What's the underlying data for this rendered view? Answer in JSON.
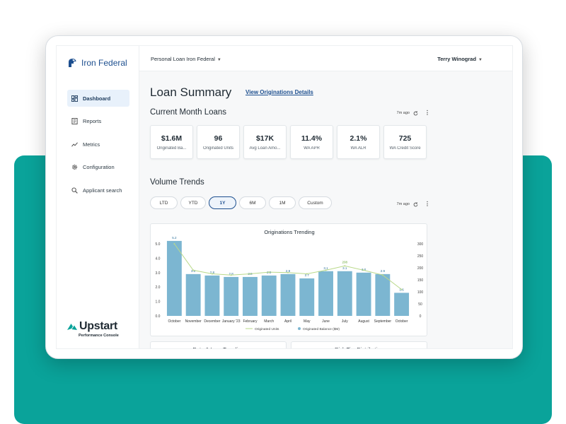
{
  "brand": {
    "name": "Iron Federal"
  },
  "sidebar": {
    "items": [
      {
        "label": "Dashboard",
        "icon": "dashboard-icon",
        "active": true
      },
      {
        "label": "Reports",
        "icon": "reports-icon",
        "active": false
      },
      {
        "label": "Metrics",
        "icon": "metrics-icon",
        "active": false
      },
      {
        "label": "Configuration",
        "icon": "gear-icon",
        "active": false
      },
      {
        "label": "Applicant search",
        "icon": "search-icon",
        "active": false
      }
    ],
    "footer": {
      "name": "Upstart",
      "subtitle": "Performance Console"
    }
  },
  "topbar": {
    "product": "Personal Loan Iron Federal",
    "user": "Terry Winograd"
  },
  "page": {
    "title": "Loan Summary",
    "details_link": "View Originations Details"
  },
  "current_month": {
    "title": "Current Month Loans",
    "updated": "7m ago",
    "kpis": [
      {
        "value": "$1.6M",
        "label": "Originated Ba..."
      },
      {
        "value": "96",
        "label": "Originated Units"
      },
      {
        "value": "$17K",
        "label": "Avg Loan Amo..."
      },
      {
        "value": "11.4%",
        "label": "WA APR"
      },
      {
        "value": "2.1%",
        "label": "WA ALR"
      },
      {
        "value": "725",
        "label": "WA Credit Score"
      }
    ]
  },
  "volume_trends": {
    "title": "Volume Trends",
    "updated": "7m ago",
    "ranges": [
      "LTD",
      "YTD",
      "1Y",
      "6M",
      "1M",
      "Custom"
    ],
    "active_range": "1Y"
  },
  "cards": {
    "rate_loss": "Rate & Loss Trending",
    "risk_tier": "Risk Tier Distribution"
  },
  "colors": {
    "accent": "#1d4f8f",
    "teal": "#0aa39a",
    "bar": "#7cb6d1",
    "line": "#b9d98a"
  },
  "chart_data": {
    "type": "bar",
    "title": "Originations Trending",
    "categories": [
      "October",
      "November",
      "December",
      "January '23",
      "February",
      "March",
      "April",
      "May",
      "June",
      "July",
      "August",
      "September",
      "October"
    ],
    "series": [
      {
        "name": "Originated Balance ($M)",
        "type": "bar",
        "axis": "left",
        "values": [
          5.2,
          2.9,
          2.8,
          2.7,
          2.7,
          2.8,
          2.9,
          2.6,
          3.1,
          3.1,
          3.0,
          2.9,
          1.6
        ],
        "labels": [
          "5.2",
          "3.0",
          "2.8",
          "2.8",
          "2.9",
          "2.9",
          "2.9",
          "2.7",
          "3.1",
          "3.1",
          "3.0",
          "2.9",
          "1.6"
        ]
      },
      {
        "name": "Originated Units",
        "type": "line",
        "axis": "right",
        "values": [
          300,
          190,
          175,
          170,
          175,
          182,
          180,
          175,
          190,
          208,
          190,
          170,
          110
        ],
        "labels": [
          "",
          "",
          "",
          "",
          "",
          "",
          "",
          "",
          "",
          "208",
          "",
          "",
          ""
        ]
      }
    ],
    "ylim_left": [
      0,
      5.0
    ],
    "yticks_left": [
      "0.0",
      "1.0",
      "2.0",
      "3.0",
      "4.0",
      "5.0"
    ],
    "ylim_right": [
      0,
      300
    ],
    "yticks_right": [
      "0",
      "50",
      "100",
      "150",
      "200",
      "250",
      "300"
    ],
    "legend": "bottom"
  }
}
